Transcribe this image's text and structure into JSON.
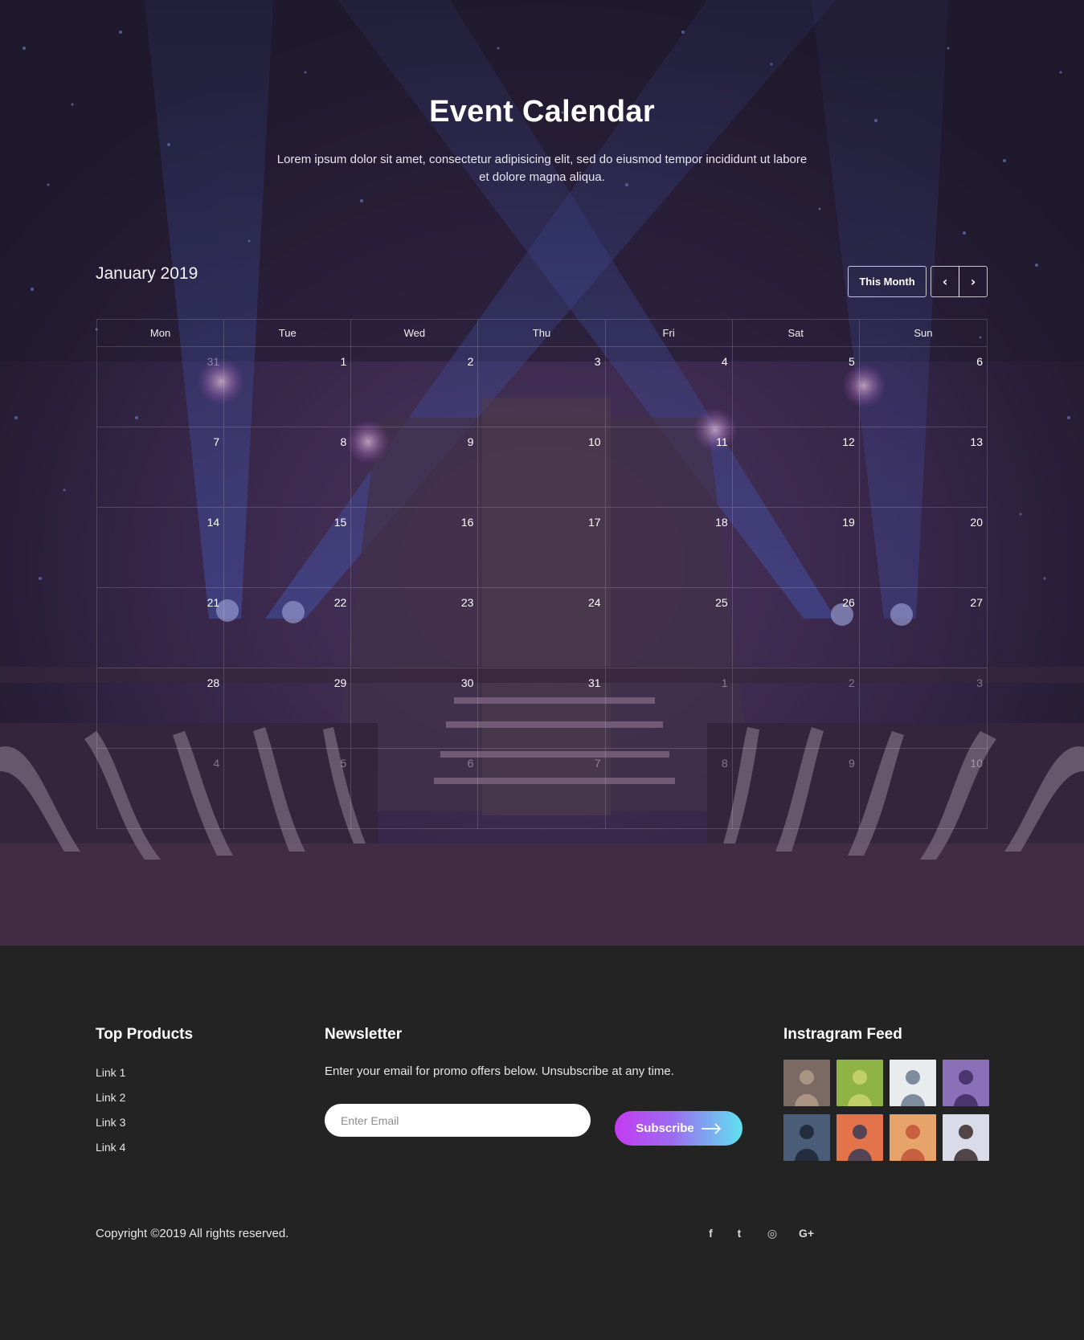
{
  "hero": {
    "title": "Event Calendar",
    "subtitle": "Lorem ipsum dolor sit amet, consectetur adipisicing elit, sed do eiusmod tempor incididunt ut labore et dolore magna aliqua."
  },
  "calendar": {
    "month_label": "January 2019",
    "this_month_label": "This Month",
    "prev_label": "‹",
    "next_label": "›",
    "weekdays": [
      "Mon",
      "Tue",
      "Wed",
      "Thu",
      "Fri",
      "Sat",
      "Sun"
    ],
    "weeks": [
      [
        {
          "d": "31",
          "muted": true
        },
        {
          "d": "1"
        },
        {
          "d": "2"
        },
        {
          "d": "3"
        },
        {
          "d": "4"
        },
        {
          "d": "5"
        },
        {
          "d": "6"
        }
      ],
      [
        {
          "d": "7"
        },
        {
          "d": "8"
        },
        {
          "d": "9"
        },
        {
          "d": "10"
        },
        {
          "d": "11"
        },
        {
          "d": "12"
        },
        {
          "d": "13"
        }
      ],
      [
        {
          "d": "14"
        },
        {
          "d": "15"
        },
        {
          "d": "16"
        },
        {
          "d": "17"
        },
        {
          "d": "18"
        },
        {
          "d": "19"
        },
        {
          "d": "20"
        }
      ],
      [
        {
          "d": "21"
        },
        {
          "d": "22"
        },
        {
          "d": "23"
        },
        {
          "d": "24"
        },
        {
          "d": "25"
        },
        {
          "d": "26"
        },
        {
          "d": "27"
        }
      ],
      [
        {
          "d": "28"
        },
        {
          "d": "29"
        },
        {
          "d": "30"
        },
        {
          "d": "31"
        },
        {
          "d": "1",
          "muted": true
        },
        {
          "d": "2",
          "muted": true
        },
        {
          "d": "3",
          "muted": true
        }
      ],
      [
        {
          "d": "4",
          "muted": true
        },
        {
          "d": "5",
          "muted": true
        },
        {
          "d": "6",
          "muted": true
        },
        {
          "d": "7",
          "muted": true
        },
        {
          "d": "8",
          "muted": true
        },
        {
          "d": "9",
          "muted": true
        },
        {
          "d": "10",
          "muted": true
        }
      ]
    ]
  },
  "footer": {
    "top_products": {
      "heading": "Top Products",
      "links": [
        "Link 1",
        "Link 2",
        "Link 3",
        "Link 4"
      ]
    },
    "newsletter": {
      "heading": "Newsletter",
      "text": "Enter your email for promo offers below. Unsubscribe at any time.",
      "email_placeholder": "Enter Email",
      "email_value": "",
      "subscribe_label": "Subscribe"
    },
    "instagram": {
      "heading": "Instragram Feed",
      "photos": [
        {
          "icon": "child-photo",
          "bg": "#7a6a63",
          "fg": "#b59b8a"
        },
        {
          "icon": "rice-field-photo",
          "bg": "#8fb345",
          "fg": "#c9d46e"
        },
        {
          "icon": "girl-backpack-photo",
          "bg": "#e9ecef",
          "fg": "#6b7d8f"
        },
        {
          "icon": "taj-mahal-photo",
          "bg": "#8b6fb8",
          "fg": "#3e2c62"
        },
        {
          "icon": "traveler-suitcase-photo",
          "bg": "#4a5d78",
          "fg": "#1d2533"
        },
        {
          "icon": "sunset-beach-photo",
          "bg": "#e2734a",
          "fg": "#3b3b55"
        },
        {
          "icon": "hat-woman-photo",
          "bg": "#e7a46a",
          "fg": "#c0553a"
        },
        {
          "icon": "girl-hood-photo",
          "bg": "#d9dbe8",
          "fg": "#3a2a2a"
        }
      ]
    },
    "copyright": "Copyright ©2019 All rights reserved.",
    "socials": [
      {
        "icon": "facebook-icon",
        "glyph": "f"
      },
      {
        "icon": "twitter-icon",
        "glyph": "t"
      },
      {
        "icon": "instagram-icon",
        "glyph": "◎"
      },
      {
        "icon": "google-plus-icon",
        "glyph": "G+"
      }
    ]
  },
  "colors": {
    "footer_bg": "#232323",
    "hero_bg": "#1d1b28",
    "subscribe_gradient": [
      "#c43bf2",
      "#5fe3f0"
    ]
  }
}
